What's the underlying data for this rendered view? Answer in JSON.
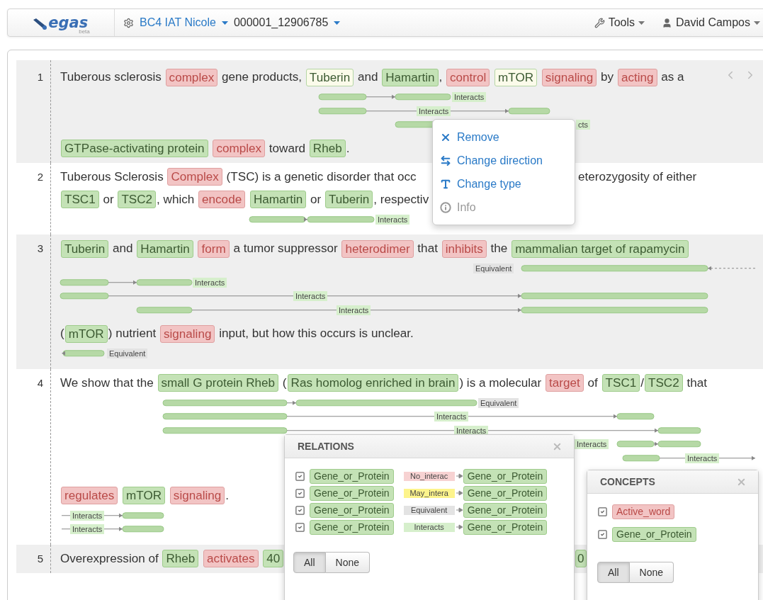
{
  "navbar": {
    "logo": {
      "name": "egas",
      "tag": "beta"
    },
    "project": "BC4 IAT Nicole",
    "document": "000001_12906785",
    "tools": "Tools",
    "user": "David Campos"
  },
  "lines": [
    {
      "number": "1",
      "shaded": true,
      "rows": [
        {
          "tokens": [
            {
              "kind": "text",
              "text": "Tuberous sclerosis "
            },
            {
              "kind": "active",
              "text": "complex"
            },
            {
              "kind": "text",
              "text": " gene products, "
            },
            {
              "kind": "gene-pale",
              "text": "Tuberin"
            },
            {
              "kind": "text",
              "text": " and "
            },
            {
              "kind": "gene",
              "text": "Hamartin"
            },
            {
              "kind": "text",
              "text": ", "
            },
            {
              "kind": "active",
              "text": "control"
            },
            {
              "kind": "space"
            },
            {
              "kind": "gene-pale",
              "text": "mTOR"
            },
            {
              "kind": "space"
            },
            {
              "kind": "active",
              "text": "signaling"
            },
            {
              "kind": "text",
              "text": " by "
            },
            {
              "kind": "active",
              "text": "acting"
            },
            {
              "kind": "text",
              "text": " as a"
            }
          ],
          "relations": [
            {
              "label": "Interacts",
              "kind": "interacts"
            },
            {
              "label": "Interacts",
              "kind": "interacts"
            },
            {
              "label": "cts",
              "kind": "interacts"
            }
          ]
        },
        {
          "tokens": [
            {
              "kind": "gene",
              "text": "GTPase-activating protein"
            },
            {
              "kind": "space"
            },
            {
              "kind": "active",
              "text": "complex"
            },
            {
              "kind": "text",
              "text": " toward "
            },
            {
              "kind": "gene",
              "text": "Rheb"
            },
            {
              "kind": "text",
              "text": "."
            }
          ]
        }
      ]
    },
    {
      "number": "2",
      "shaded": false,
      "rows": [
        {
          "tokens": [
            {
              "kind": "text",
              "text": "Tuberous Sclerosis "
            },
            {
              "kind": "active",
              "text": "Complex"
            },
            {
              "kind": "text",
              "text": " (TSC) is a genetic disorder that occ"
            },
            {
              "kind": "covered"
            },
            {
              "kind": "text",
              "text": "eterozygosity of either"
            }
          ]
        },
        {
          "tokens": [
            {
              "kind": "gene",
              "text": "TSC1"
            },
            {
              "kind": "text",
              "text": " or "
            },
            {
              "kind": "gene",
              "text": "TSC2"
            },
            {
              "kind": "text",
              "text": ", which "
            },
            {
              "kind": "active",
              "text": "encode"
            },
            {
              "kind": "space"
            },
            {
              "kind": "gene",
              "text": "Hamartin"
            },
            {
              "kind": "text",
              "text": " or "
            },
            {
              "kind": "gene",
              "text": "Tuberin"
            },
            {
              "kind": "text",
              "text": ", respectiv"
            }
          ],
          "relations": [
            {
              "label": "Interacts",
              "kind": "interacts"
            }
          ]
        }
      ]
    },
    {
      "number": "3",
      "shaded": true,
      "rows": [
        {
          "tokens": [
            {
              "kind": "gene",
              "text": "Tuberin"
            },
            {
              "kind": "text",
              "text": " and "
            },
            {
              "kind": "gene",
              "text": "Hamartin"
            },
            {
              "kind": "space"
            },
            {
              "kind": "active",
              "text": "form"
            },
            {
              "kind": "text",
              "text": " a tumor suppressor "
            },
            {
              "kind": "active",
              "text": "heterodimer"
            },
            {
              "kind": "text",
              "text": " that "
            },
            {
              "kind": "active",
              "text": "inhibits"
            },
            {
              "kind": "text",
              "text": " the "
            },
            {
              "kind": "gene",
              "text": "mammalian target of rapamycin"
            }
          ],
          "relations": [
            {
              "label": "Equivalent",
              "kind": "equivalent"
            },
            {
              "label": "Interacts",
              "kind": "interacts"
            },
            {
              "label": "Interacts",
              "kind": "interacts"
            },
            {
              "label": "Interacts",
              "kind": "interacts"
            }
          ]
        },
        {
          "tokens": [
            {
              "kind": "text",
              "text": "("
            },
            {
              "kind": "gene",
              "text": "mTOR"
            },
            {
              "kind": "text",
              "text": ") nutrient "
            },
            {
              "kind": "active",
              "text": "signaling"
            },
            {
              "kind": "text",
              "text": " input, but how this occurs is unclear."
            }
          ],
          "relations": [
            {
              "label": "Equivalent",
              "kind": "equivalent"
            }
          ]
        }
      ]
    },
    {
      "number": "4",
      "shaded": false,
      "rows": [
        {
          "tokens": [
            {
              "kind": "text",
              "text": "We show that the "
            },
            {
              "kind": "gene",
              "text": "small G protein Rheb"
            },
            {
              "kind": "text",
              "text": " ("
            },
            {
              "kind": "gene",
              "text": "Ras homolog enriched in brain"
            },
            {
              "kind": "text",
              "text": ") is a molecular "
            },
            {
              "kind": "active",
              "text": "target"
            },
            {
              "kind": "text",
              "text": " of "
            },
            {
              "kind": "gene",
              "text": "TSC1"
            },
            {
              "kind": "text",
              "text": "/"
            },
            {
              "kind": "gene",
              "text": "TSC2"
            },
            {
              "kind": "text",
              "text": " that"
            }
          ],
          "relations": [
            {
              "label": "Equivalent",
              "kind": "equivalent"
            },
            {
              "label": "Interacts",
              "kind": "interacts"
            },
            {
              "label": "Interacts",
              "kind": "interacts"
            },
            {
              "label": "Interacts",
              "kind": "interacts"
            },
            {
              "label": "Interacts",
              "kind": "interacts"
            }
          ]
        },
        {
          "tokens": [
            {
              "kind": "active",
              "text": "regulates"
            },
            {
              "kind": "space"
            },
            {
              "kind": "gene",
              "text": "mTOR"
            },
            {
              "kind": "space"
            },
            {
              "kind": "active",
              "text": "signaling"
            },
            {
              "kind": "text",
              "text": "."
            }
          ],
          "relations": [
            {
              "label": "Interacts",
              "kind": "interacts"
            },
            {
              "label": "Interacts",
              "kind": "interacts"
            }
          ]
        }
      ]
    },
    {
      "number": "5",
      "shaded": true,
      "rows": [
        {
          "tokens": [
            {
              "kind": "text",
              "text": "Overexpression of "
            },
            {
              "kind": "gene",
              "text": "Rheb"
            },
            {
              "kind": "space"
            },
            {
              "kind": "active",
              "text": "activates"
            },
            {
              "kind": "space"
            },
            {
              "kind": "gene",
              "text": "40"
            },
            {
              "kind": "covered"
            },
            {
              "kind": "gene",
              "text": "0"
            }
          ]
        }
      ]
    }
  ],
  "context_menu": {
    "items": [
      {
        "label": "Remove",
        "disabled": false
      },
      {
        "label": "Change direction",
        "disabled": false
      },
      {
        "label": "Change type",
        "disabled": false
      },
      {
        "label": "Info",
        "disabled": true
      }
    ]
  },
  "relations_panel": {
    "title": "RELATIONS",
    "rows": [
      {
        "checked": true,
        "from": "Gene_or_Protein",
        "label": "No_interac",
        "kind": "no_interaction",
        "to": "Gene_or_Protein"
      },
      {
        "checked": true,
        "from": "Gene_or_Protein",
        "label": "May_intera",
        "kind": "may_interact",
        "to": "Gene_or_Protein"
      },
      {
        "checked": true,
        "from": "Gene_or_Protein",
        "label": "Equivalent",
        "kind": "equivalent",
        "to": "Gene_or_Protein"
      },
      {
        "checked": true,
        "from": "Gene_or_Protein",
        "label": "Interacts",
        "kind": "interacts",
        "to": "Gene_or_Protein"
      }
    ],
    "filter": [
      {
        "label": "All",
        "selected": true
      },
      {
        "label": "None",
        "selected": false
      }
    ]
  },
  "concepts_panel": {
    "title": "CONCEPTS",
    "rows": [
      {
        "checked": true,
        "label": "Active_word",
        "kind": "active"
      },
      {
        "checked": true,
        "label": "Gene_or_Protein",
        "kind": "gene"
      }
    ],
    "filter": [
      {
        "label": "All",
        "selected": true
      },
      {
        "label": "None",
        "selected": false
      }
    ]
  }
}
